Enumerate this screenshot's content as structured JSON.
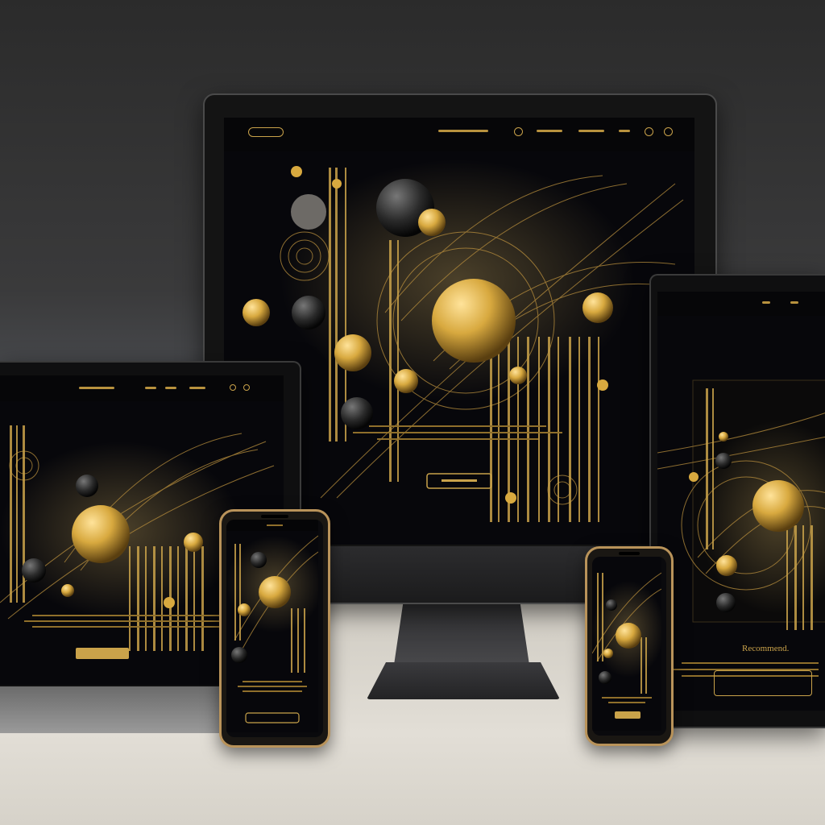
{
  "scene": {
    "description_label": "",
    "tablet_heading": "Recommend."
  },
  "colors": {
    "gold": "#c9a24a",
    "dark_gold": "#8f6f2b",
    "background_dark": "#0a0a0d"
  }
}
